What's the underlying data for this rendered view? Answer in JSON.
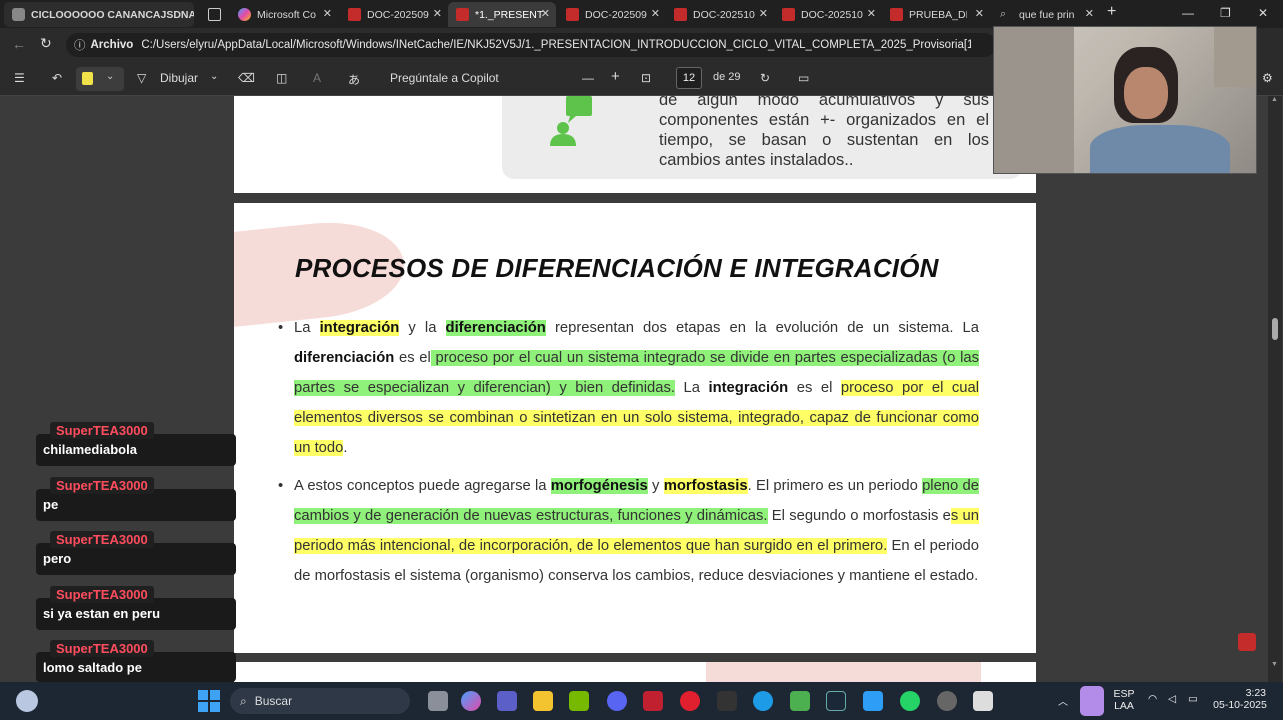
{
  "tabs": [
    {
      "label": "CICLOOOOOO CANANCAJSDNA"
    },
    {
      "label": "Microsoft Co"
    },
    {
      "label": "DOC-202509"
    },
    {
      "label": "*1._PRESENT"
    },
    {
      "label": "DOC-202509"
    },
    {
      "label": "DOC-202510"
    },
    {
      "label": "DOC-202510"
    },
    {
      "label": "PRUEBA_DE"
    },
    {
      "label": "que fue prin"
    }
  ],
  "address": {
    "prefix": "Archivo",
    "path": "C:/Users/elyru/AppData/Local/Microsoft/Windows/INetCache/IE/NKJ52V5J/1._PRESENTACIÓN_INTRODUCCIÓN_CICLO_VITAL_COMPLETA_2025_Provisoria[1].pdf"
  },
  "toolbar": {
    "draw": "Dibujar",
    "copilot": "Pregúntale a Copilot",
    "page": "12",
    "of": "de 29"
  },
  "prev_slide": {
    "text": "de algún modo acumulativos y sus componentes están +- organizados en el tiempo, se basan o sustentan en los cambios antes instalados.."
  },
  "slide": {
    "title": "PROCESOS DE DIFERENCIACIÓN E INTEGRACIÓN",
    "b1": {
      "t1": "La ",
      "k1": "integración",
      "t2": " y la ",
      "k2": "diferenciación",
      "t3": " representan dos etapas en la evolución de un sistema. La ",
      "k3": "diferenciación",
      "t4": " es el",
      "h1": " proceso por el cual un sistema integrado se divide en partes especializadas (o las partes se especializan y diferencian) y bien definidas.",
      "t5": " La ",
      "k4": "integración",
      "t6": " es el ",
      "h2": "proceso por el cual elementos diversos se combinan o sintetizan en un solo sistema, integrado, capaz de funcionar como un todo",
      "t7": "."
    },
    "b2": {
      "t1": "A estos conceptos puede agregarse la ",
      "k1": "morfogénesis",
      "t2": " y ",
      "k2": "morfostasis",
      "t3": ". El primero es un periodo ",
      "h1": "pleno de cambios y de generación de nuevas estructuras, funciones y dinámicas.",
      "t4": " El segundo o morfostasis e",
      "h2": "s un periodo más intencional, de incorporación, de lo elementos que han surgido en el primero.",
      "t5": " En el periodo de morfostasis el sistema (organismo) conserva los cambios, reduce desviaciones y mantiene el estado."
    }
  },
  "chat": [
    {
      "user": "SuperTEA3000",
      "msg": "chilamediabola"
    },
    {
      "user": "SuperTEA3000",
      "msg": "pe"
    },
    {
      "user": "SuperTEA3000",
      "msg": "pero"
    },
    {
      "user": "SuperTEA3000",
      "msg": "si ya estan en peru"
    },
    {
      "user": "SuperTEA3000",
      "msg": "lomo saltado pe"
    }
  ],
  "taskbar": {
    "search": "Buscar",
    "lang1": "ESP",
    "lang2": "LAA",
    "time": "3:23",
    "date": "05-10-2025"
  }
}
